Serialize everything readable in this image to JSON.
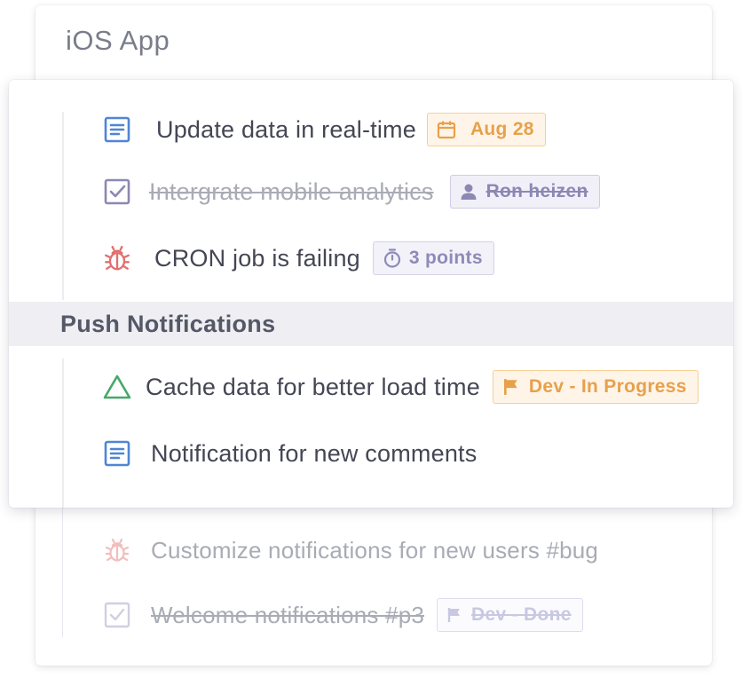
{
  "project": {
    "title": "iOS App"
  },
  "tasks": [
    {
      "title": "Update data in real-time",
      "icon": "document-icon",
      "done": false,
      "tag": {
        "icon": "calendar-icon",
        "label": "Aug 28"
      }
    },
    {
      "title": "Intergrate mobile analytics",
      "icon": "checkbox-checked-icon",
      "done": true,
      "tag": {
        "icon": "user-icon",
        "label": "Ron heizen"
      }
    },
    {
      "title": "CRON job is failing",
      "icon": "bug-icon",
      "done": false,
      "tag": {
        "icon": "stopwatch-icon",
        "label": "3 points"
      }
    }
  ],
  "group": {
    "name": "Push Notifications",
    "tasks": [
      {
        "title": "Cache data for better load time",
        "icon": "triangle-icon",
        "done": false,
        "tag": {
          "icon": "flag-icon",
          "label": "Dev - In Progress"
        }
      },
      {
        "title": "Notification for new comments",
        "icon": "document-icon",
        "done": false
      }
    ]
  },
  "faded_tasks": [
    {
      "title": "Customize notifications for new users #bug",
      "icon": "bug-icon",
      "done": false
    },
    {
      "title": "Welcome notifications #p3",
      "icon": "checkbox-checked-icon",
      "done": true,
      "tag": {
        "icon": "flag-icon",
        "label": "Dev - Done"
      }
    }
  ],
  "colors": {
    "document": "#4f86d6",
    "checkbox": "#8c88b3",
    "bug": "#e2706f",
    "triangle": "#47a86a",
    "tag_orange": "#e8a04c",
    "tag_purple": "#8e8ab8"
  }
}
